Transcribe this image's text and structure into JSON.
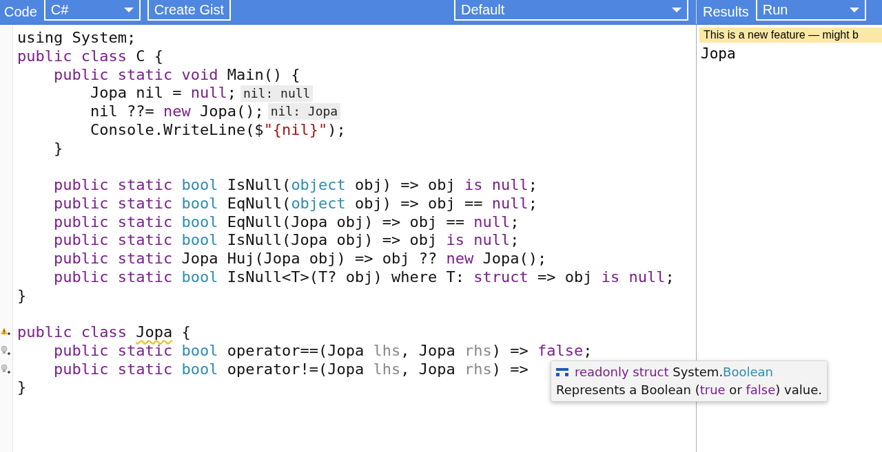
{
  "toolbar": {
    "code_label": "Code",
    "language": "C#",
    "create_gist": "Create Gist",
    "mode": "Default",
    "results_label": "Results",
    "run_mode": "Run"
  },
  "editor": {
    "lines": [
      {
        "kind": "code",
        "tokens": [
          {
            "kind": "plain",
            "text": "using System;"
          }
        ]
      },
      {
        "kind": "code",
        "tokens": [
          {
            "kind": "keyword",
            "text": "public class"
          },
          {
            "kind": "plain",
            "text": " C {"
          }
        ]
      },
      {
        "kind": "code",
        "tokens": [
          {
            "kind": "keyword",
            "text": "    public static void"
          },
          {
            "kind": "plain",
            "text": " Main() {"
          }
        ]
      },
      {
        "kind": "code",
        "tokens": [
          {
            "kind": "plain",
            "text": "        Jopa nil = "
          },
          {
            "kind": "keyword",
            "text": "null"
          },
          {
            "kind": "plain",
            "text": ";"
          },
          {
            "kind": "hint",
            "text": "nil: null"
          }
        ]
      },
      {
        "kind": "code",
        "tokens": [
          {
            "kind": "plain",
            "text": "        nil ??= "
          },
          {
            "kind": "keyword",
            "text": "new"
          },
          {
            "kind": "plain",
            "text": " Jopa();"
          },
          {
            "kind": "hint",
            "text": "nil: Jopa"
          }
        ]
      },
      {
        "kind": "code",
        "tokens": [
          {
            "kind": "plain",
            "text": "        Console.WriteLine($"
          },
          {
            "kind": "string",
            "text": "\"{nil}\""
          },
          {
            "kind": "plain",
            "text": ");"
          }
        ]
      },
      {
        "kind": "code",
        "tokens": [
          {
            "kind": "plain",
            "text": "    }"
          }
        ]
      },
      {
        "kind": "blank"
      },
      {
        "kind": "code",
        "tokens": [
          {
            "kind": "keyword",
            "text": "    public static "
          },
          {
            "kind": "type",
            "text": "bool"
          },
          {
            "kind": "plain",
            "text": " IsNull("
          },
          {
            "kind": "type",
            "text": "object"
          },
          {
            "kind": "plain",
            "text": " obj) => obj "
          },
          {
            "kind": "keyword",
            "text": "is null"
          },
          {
            "kind": "plain",
            "text": ";"
          }
        ]
      },
      {
        "kind": "code",
        "tokens": [
          {
            "kind": "keyword",
            "text": "    public static "
          },
          {
            "kind": "type",
            "text": "bool"
          },
          {
            "kind": "plain",
            "text": " EqNull("
          },
          {
            "kind": "type",
            "text": "object"
          },
          {
            "kind": "plain",
            "text": " obj) => obj == "
          },
          {
            "kind": "keyword",
            "text": "null"
          },
          {
            "kind": "plain",
            "text": ";"
          }
        ]
      },
      {
        "kind": "code",
        "tokens": [
          {
            "kind": "keyword",
            "text": "    public static "
          },
          {
            "kind": "type",
            "text": "bool"
          },
          {
            "kind": "plain",
            "text": " EqNull(Jopa obj) => obj == "
          },
          {
            "kind": "keyword",
            "text": "null"
          },
          {
            "kind": "plain",
            "text": ";"
          }
        ]
      },
      {
        "kind": "code",
        "tokens": [
          {
            "kind": "keyword",
            "text": "    public static "
          },
          {
            "kind": "type",
            "text": "bool"
          },
          {
            "kind": "plain",
            "text": " IsNull(Jopa obj) => obj "
          },
          {
            "kind": "keyword",
            "text": "is null"
          },
          {
            "kind": "plain",
            "text": ";"
          }
        ]
      },
      {
        "kind": "code",
        "tokens": [
          {
            "kind": "keyword",
            "text": "    public static"
          },
          {
            "kind": "plain",
            "text": " Jopa Huj(Jopa obj) => obj ?? "
          },
          {
            "kind": "keyword",
            "text": "new"
          },
          {
            "kind": "plain",
            "text": " Jopa();"
          }
        ]
      },
      {
        "kind": "code",
        "tokens": [
          {
            "kind": "keyword",
            "text": "    public static "
          },
          {
            "kind": "type",
            "text": "bool"
          },
          {
            "kind": "plain",
            "text": " IsNull<T>(T? obj) where T: "
          },
          {
            "kind": "keyword",
            "text": "struct"
          },
          {
            "kind": "plain",
            "text": " => obj "
          },
          {
            "kind": "keyword",
            "text": "is null"
          },
          {
            "kind": "plain",
            "text": ";"
          }
        ]
      },
      {
        "kind": "code",
        "tokens": [
          {
            "kind": "plain",
            "text": "}"
          }
        ]
      },
      {
        "kind": "blank"
      },
      {
        "kind": "code",
        "gutter": {
          "kind": "warning"
        },
        "tokens": [
          {
            "kind": "keyword",
            "text": "public class "
          },
          {
            "kind": "warn",
            "text": "Jopa"
          },
          {
            "kind": "plain",
            "text": " {"
          }
        ]
      },
      {
        "kind": "code",
        "gutter": {
          "kind": "bulb"
        },
        "tokens": [
          {
            "kind": "keyword",
            "text": "    public static "
          },
          {
            "kind": "type",
            "text": "bool"
          },
          {
            "kind": "plain",
            "text": " operator==(Jopa "
          },
          {
            "kind": "param",
            "text": "lhs"
          },
          {
            "kind": "plain",
            "text": ", Jopa "
          },
          {
            "kind": "param",
            "text": "rhs"
          },
          {
            "kind": "plain",
            "text": ") => "
          },
          {
            "kind": "keyword",
            "text": "false"
          },
          {
            "kind": "plain",
            "text": ";"
          }
        ]
      },
      {
        "kind": "code",
        "gutter": {
          "kind": "bulb"
        },
        "tokens": [
          {
            "kind": "keyword",
            "text": "    public static "
          },
          {
            "kind": "type",
            "text": "bool"
          },
          {
            "kind": "plain",
            "text": " operator!=(Jopa "
          },
          {
            "kind": "param",
            "text": "lhs"
          },
          {
            "kind": "plain",
            "text": ", Jopa "
          },
          {
            "kind": "param",
            "text": "rhs"
          },
          {
            "kind": "plain",
            "text": ") =>"
          }
        ]
      },
      {
        "kind": "code",
        "tokens": [
          {
            "kind": "plain",
            "text": "}"
          }
        ]
      }
    ]
  },
  "tooltip": {
    "signature": "**readonly struct** System.*Boolean*",
    "description": "Represents a Boolean (**true** or **false**) value."
  },
  "results": {
    "banner": "This is a new feature — might b",
    "output": "Jopa"
  }
}
